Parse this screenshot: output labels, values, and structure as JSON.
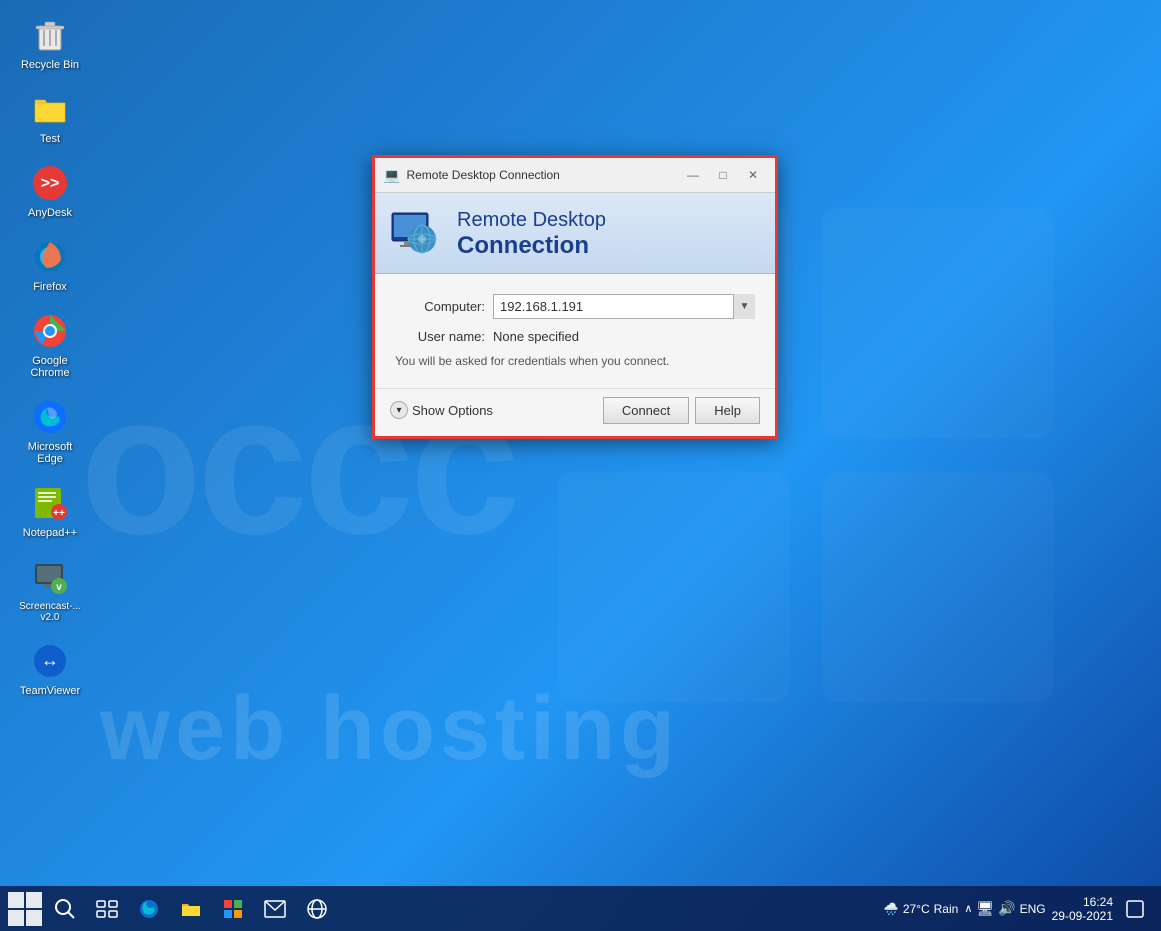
{
  "desktop": {
    "background_color": "#1565c0",
    "watermarks": {
      "occc": "occc",
      "hosting": "web hosting"
    }
  },
  "icons": [
    {
      "id": "recycle-bin",
      "label": "Recycle Bin",
      "symbol": "🗑️"
    },
    {
      "id": "test",
      "label": "Test",
      "symbol": "📁"
    },
    {
      "id": "anydesk",
      "label": "AnyDesk",
      "symbol": "🔴"
    },
    {
      "id": "firefox",
      "label": "Firefox",
      "symbol": "🦊"
    },
    {
      "id": "google-chrome",
      "label": "Google Chrome",
      "symbol": "🌐"
    },
    {
      "id": "microsoft-edge",
      "label": "Microsoft Edge",
      "symbol": "🌀"
    },
    {
      "id": "notepadpp",
      "label": "Notepad++",
      "symbol": "📝"
    },
    {
      "id": "screencast",
      "label": "Screencast-...\nv2.0",
      "symbol": "🎬"
    },
    {
      "id": "teamviewer",
      "label": "TeamViewer",
      "symbol": "↔️"
    }
  ],
  "rdc_dialog": {
    "titlebar": {
      "icon": "💻",
      "title": "Remote Desktop Connection",
      "minimize": "—",
      "maximize": "□",
      "close": "✕"
    },
    "header": {
      "line1": "Remote Desktop",
      "line2": "Connection"
    },
    "fields": {
      "computer_label": "Computer:",
      "computer_value": "192.168.1.191",
      "username_label": "User name:",
      "username_value": "None specified"
    },
    "credentials_note": "You will be asked for credentials when you connect.",
    "footer": {
      "show_options_label": "Show Options",
      "connect_label": "Connect",
      "help_label": "Help"
    }
  },
  "taskbar": {
    "weather": {
      "temp": "27°C",
      "condition": "Rain"
    },
    "lang": "ENG",
    "clock": {
      "time": "16:24",
      "date": "29-09-2021"
    }
  }
}
